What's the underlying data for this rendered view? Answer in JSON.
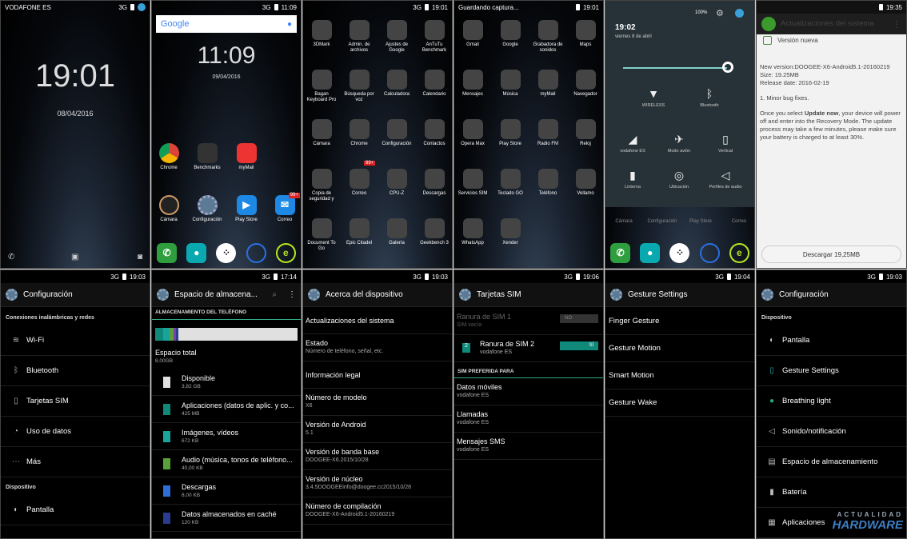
{
  "lock": {
    "carrier": "VODAFONE ES",
    "signal": "3G",
    "time": "19:01",
    "date": "08/04/2016"
  },
  "home": {
    "signal": "3G",
    "status_time": "11:09",
    "search_brand": "Google",
    "time": "11:09",
    "date": "09/04/2016",
    "apps": [
      "Chrome",
      "Benchmarks",
      "myMail",
      "Cámara",
      "Configuración",
      "Play Store",
      "Correo"
    ],
    "correo_badge": "99+"
  },
  "drawer1": {
    "signal": "3G",
    "time": "19:01",
    "badge": "99+",
    "apps": [
      "3DMark",
      "Admin. de archivos",
      "Ajustes de Google",
      "AnTuTu Benchmark",
      "Bagan Keyboard Pro",
      "Búsqueda por voz",
      "Calculadora",
      "Calendario",
      "Cámara",
      "Chrome",
      "Configuración",
      "Contactos",
      "Copia de seguridad y",
      "Correo",
      "CPU-Z",
      "Descargas",
      "Document To Go",
      "Epic Citadel",
      "Galería",
      "Geekbench 3"
    ]
  },
  "drawer2": {
    "status": "Guardando captura...",
    "time": "19:01",
    "apps": [
      "Gmail",
      "Google",
      "Grabadora de sonidos",
      "Maps",
      "Mensajes",
      "Música",
      "myMail",
      "Navegador",
      "Opera Max",
      "Play Store",
      "Radio FM",
      "Reloj",
      "Servicios SIM",
      "Teclado GO",
      "Teléfono",
      "Vellamo",
      "WhatsApp",
      "Xender"
    ]
  },
  "quick": {
    "battery": "100%",
    "time": "19:02",
    "date": "viernes 8 de abril",
    "tiles": [
      "WIRELESS",
      "Bluetooth",
      "vodafone ES",
      "Modo avión",
      "Vertical",
      "Linterna",
      "Ubicación",
      "Perfiles de audio"
    ],
    "under": [
      "Cámara",
      "Configuración",
      "Play Store",
      "Correo"
    ]
  },
  "update": {
    "time": "19:35",
    "title": "Actualizaciones del sistema",
    "new_version": "Versión nueva",
    "info": [
      "New version:DOOGEE-X6-Android5.1-20160219",
      "Size: 19.25MB",
      "Release date: 2016-02-19"
    ],
    "fixes": "1. Minor bug fixes.",
    "text_a": "Once you select ",
    "text_b": "Update now",
    "text_c": ", your device will power off and enter into the Recovery Mode. The update process may take a few minutes, please make sure your battery is charged to at least 30%.",
    "download": "Descargar  19,25MB"
  },
  "config": {
    "signal": "3G",
    "time": "19:03",
    "title": "Configuración",
    "section1": "Conexiones inalámbricas y redes",
    "items": [
      "Wi-Fi",
      "Bluetooth",
      "Tarjetas SIM",
      "Uso de datos",
      "Más"
    ],
    "section2": "Dispositivo",
    "item_last": "Pantalla"
  },
  "storage": {
    "signal": "3G",
    "time": "17:14",
    "title": "Espacio de almacena...",
    "section": "ALMACENAMIENTO DEL TELÉFONO",
    "total_label": "Espacio total",
    "total_value": "8,00GB",
    "items": [
      {
        "label": "Disponible",
        "value": "3,82 GB",
        "color": "#e0e0e0"
      },
      {
        "label": "Aplicaciones (datos de aplic. y co...",
        "value": "425 MB",
        "color": "#0f8a7a"
      },
      {
        "label": "Imágenes, vídeos",
        "value": "672 KB",
        "color": "#1aa39b"
      },
      {
        "label": "Audio (música, tonos de teléfono...",
        "value": "40,00 KB",
        "color": "#5aa03a"
      },
      {
        "label": "Descargas",
        "value": "8,00 KB",
        "color": "#2e6fd6"
      },
      {
        "label": "Datos almacenados en caché",
        "value": "120 KB",
        "color": "#2a3c8f"
      }
    ]
  },
  "about": {
    "signal": "3G",
    "time": "19:03",
    "title": "Acerca del dispositivo",
    "items": [
      {
        "t": "Actualizaciones del sistema",
        "s": ""
      },
      {
        "t": "Estado",
        "s": "Número de teléfono, señal, etc."
      },
      {
        "t": "Información legal",
        "s": ""
      },
      {
        "t": "Número de modelo",
        "s": "X6"
      },
      {
        "t": "Versión de Android",
        "s": "5.1"
      },
      {
        "t": "Versión de banda base",
        "s": "DOOGEE-X6.2015/10/28"
      },
      {
        "t": "Versión de núcleo",
        "s": "3.4.5DOOGEEinfo@doogee.cc2015/10/28"
      },
      {
        "t": "Número de compilación",
        "s": "DOOGEE-X6-Android5.1-20160219"
      }
    ]
  },
  "sim": {
    "signal": "3G",
    "time": "19:06",
    "title": "Tarjetas SIM",
    "slot1": "Ranura de SIM 1",
    "slot1_sub": "SIM vacía",
    "no": "NO",
    "slot2": "Ranura de SIM 2",
    "slot2_sub": "vodafone ES",
    "si": "SÍ",
    "slot2_num": "2",
    "section": "SIM PREFERIDA PARA",
    "items": [
      {
        "t": "Datos móviles",
        "s": "vodafone ES"
      },
      {
        "t": "Llamadas",
        "s": "vodafone ES"
      },
      {
        "t": "Mensajes SMS",
        "s": "vodafone ES"
      }
    ]
  },
  "gesture": {
    "signal": "3G",
    "time": "19:04",
    "title": "Gesture Settings",
    "items": [
      "Finger Gesture",
      "Gesture Motion",
      "Smart Motion",
      "Gesture Wake"
    ]
  },
  "config2": {
    "signal": "3G",
    "time": "19:03",
    "title": "Configuración",
    "section": "Dispositivo",
    "items": [
      "Pantalla",
      "Gesture Settings",
      "Breathing light",
      "Sonido/notificación",
      "Espacio de almacenamiento",
      "Batería",
      "Aplicaciones"
    ]
  },
  "watermark": {
    "line1": "ACTUALIDAD",
    "line2": "HARDWARE"
  }
}
